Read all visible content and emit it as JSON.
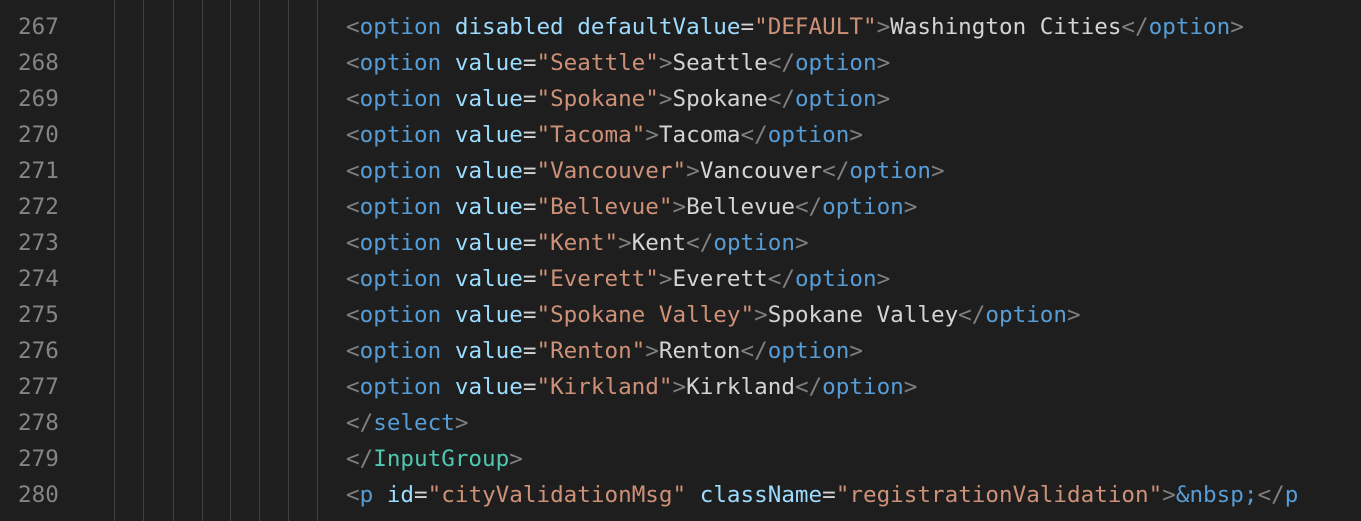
{
  "editor": {
    "top_partial": "/ , / , ,",
    "lines": [
      {
        "number": "267",
        "tokens": [
          {
            "k": "punct",
            "t": "<"
          },
          {
            "k": "tag",
            "t": "option"
          },
          {
            "k": "text",
            "t": " "
          },
          {
            "k": "attr",
            "t": "disabled"
          },
          {
            "k": "text",
            "t": " "
          },
          {
            "k": "attr",
            "t": "defaultValue"
          },
          {
            "k": "eq",
            "t": "="
          },
          {
            "k": "str",
            "t": "\"DEFAULT\""
          },
          {
            "k": "punct",
            "t": ">"
          },
          {
            "k": "text",
            "t": "Washington Cities"
          },
          {
            "k": "punct",
            "t": "</"
          },
          {
            "k": "tag",
            "t": "option"
          },
          {
            "k": "punct",
            "t": ">"
          }
        ]
      },
      {
        "number": "268",
        "tokens": [
          {
            "k": "punct",
            "t": "<"
          },
          {
            "k": "tag",
            "t": "option"
          },
          {
            "k": "text",
            "t": " "
          },
          {
            "k": "attr",
            "t": "value"
          },
          {
            "k": "eq",
            "t": "="
          },
          {
            "k": "str",
            "t": "\"Seattle\""
          },
          {
            "k": "punct",
            "t": ">"
          },
          {
            "k": "text",
            "t": "Seattle"
          },
          {
            "k": "punct",
            "t": "</"
          },
          {
            "k": "tag",
            "t": "option"
          },
          {
            "k": "punct",
            "t": ">"
          }
        ]
      },
      {
        "number": "269",
        "tokens": [
          {
            "k": "punct",
            "t": "<"
          },
          {
            "k": "tag",
            "t": "option"
          },
          {
            "k": "text",
            "t": " "
          },
          {
            "k": "attr",
            "t": "value"
          },
          {
            "k": "eq",
            "t": "="
          },
          {
            "k": "str",
            "t": "\"Spokane\""
          },
          {
            "k": "punct",
            "t": ">"
          },
          {
            "k": "text",
            "t": "Spokane"
          },
          {
            "k": "punct",
            "t": "</"
          },
          {
            "k": "tag",
            "t": "option"
          },
          {
            "k": "punct",
            "t": ">"
          }
        ]
      },
      {
        "number": "270",
        "tokens": [
          {
            "k": "punct",
            "t": "<"
          },
          {
            "k": "tag",
            "t": "option"
          },
          {
            "k": "text",
            "t": " "
          },
          {
            "k": "attr",
            "t": "value"
          },
          {
            "k": "eq",
            "t": "="
          },
          {
            "k": "str",
            "t": "\"Tacoma\""
          },
          {
            "k": "punct",
            "t": ">"
          },
          {
            "k": "text",
            "t": "Tacoma"
          },
          {
            "k": "punct",
            "t": "</"
          },
          {
            "k": "tag",
            "t": "option"
          },
          {
            "k": "punct",
            "t": ">"
          }
        ]
      },
      {
        "number": "271",
        "tokens": [
          {
            "k": "punct",
            "t": "<"
          },
          {
            "k": "tag",
            "t": "option"
          },
          {
            "k": "text",
            "t": " "
          },
          {
            "k": "attr",
            "t": "value"
          },
          {
            "k": "eq",
            "t": "="
          },
          {
            "k": "str",
            "t": "\"Vancouver\""
          },
          {
            "k": "punct",
            "t": ">"
          },
          {
            "k": "text",
            "t": "Vancouver"
          },
          {
            "k": "punct",
            "t": "</"
          },
          {
            "k": "tag",
            "t": "option"
          },
          {
            "k": "punct",
            "t": ">"
          }
        ]
      },
      {
        "number": "272",
        "tokens": [
          {
            "k": "punct",
            "t": "<"
          },
          {
            "k": "tag",
            "t": "option"
          },
          {
            "k": "text",
            "t": " "
          },
          {
            "k": "attr",
            "t": "value"
          },
          {
            "k": "eq",
            "t": "="
          },
          {
            "k": "str",
            "t": "\"Bellevue\""
          },
          {
            "k": "punct",
            "t": ">"
          },
          {
            "k": "text",
            "t": "Bellevue"
          },
          {
            "k": "punct",
            "t": "</"
          },
          {
            "k": "tag",
            "t": "option"
          },
          {
            "k": "punct",
            "t": ">"
          }
        ]
      },
      {
        "number": "273",
        "tokens": [
          {
            "k": "punct",
            "t": "<"
          },
          {
            "k": "tag",
            "t": "option"
          },
          {
            "k": "text",
            "t": " "
          },
          {
            "k": "attr",
            "t": "value"
          },
          {
            "k": "eq",
            "t": "="
          },
          {
            "k": "str",
            "t": "\"Kent\""
          },
          {
            "k": "punct",
            "t": ">"
          },
          {
            "k": "text",
            "t": "Kent"
          },
          {
            "k": "punct",
            "t": "</"
          },
          {
            "k": "tag",
            "t": "option"
          },
          {
            "k": "punct",
            "t": ">"
          }
        ]
      },
      {
        "number": "274",
        "tokens": [
          {
            "k": "punct",
            "t": "<"
          },
          {
            "k": "tag",
            "t": "option"
          },
          {
            "k": "text",
            "t": " "
          },
          {
            "k": "attr",
            "t": "value"
          },
          {
            "k": "eq",
            "t": "="
          },
          {
            "k": "str",
            "t": "\"Everett\""
          },
          {
            "k": "punct",
            "t": ">"
          },
          {
            "k": "text",
            "t": "Everett"
          },
          {
            "k": "punct",
            "t": "</"
          },
          {
            "k": "tag",
            "t": "option"
          },
          {
            "k": "punct",
            "t": ">"
          }
        ]
      },
      {
        "number": "275",
        "tokens": [
          {
            "k": "punct",
            "t": "<"
          },
          {
            "k": "tag",
            "t": "option"
          },
          {
            "k": "text",
            "t": " "
          },
          {
            "k": "attr",
            "t": "value"
          },
          {
            "k": "eq",
            "t": "="
          },
          {
            "k": "str",
            "t": "\"Spokane Valley\""
          },
          {
            "k": "punct",
            "t": ">"
          },
          {
            "k": "text",
            "t": "Spokane Valley"
          },
          {
            "k": "punct",
            "t": "</"
          },
          {
            "k": "tag",
            "t": "option"
          },
          {
            "k": "punct",
            "t": ">"
          }
        ]
      },
      {
        "number": "276",
        "tokens": [
          {
            "k": "punct",
            "t": "<"
          },
          {
            "k": "tag",
            "t": "option"
          },
          {
            "k": "text",
            "t": " "
          },
          {
            "k": "attr",
            "t": "value"
          },
          {
            "k": "eq",
            "t": "="
          },
          {
            "k": "str",
            "t": "\"Renton\""
          },
          {
            "k": "punct",
            "t": ">"
          },
          {
            "k": "text",
            "t": "Renton"
          },
          {
            "k": "punct",
            "t": "</"
          },
          {
            "k": "tag",
            "t": "option"
          },
          {
            "k": "punct",
            "t": ">"
          }
        ]
      },
      {
        "number": "277",
        "tokens": [
          {
            "k": "punct",
            "t": "<"
          },
          {
            "k": "tag",
            "t": "option"
          },
          {
            "k": "text",
            "t": " "
          },
          {
            "k": "attr",
            "t": "value"
          },
          {
            "k": "eq",
            "t": "="
          },
          {
            "k": "str",
            "t": "\"Kirkland\""
          },
          {
            "k": "punct",
            "t": ">"
          },
          {
            "k": "text",
            "t": "Kirkland"
          },
          {
            "k": "punct",
            "t": "</"
          },
          {
            "k": "tag",
            "t": "option"
          },
          {
            "k": "punct",
            "t": ">"
          }
        ]
      },
      {
        "number": "278",
        "tokens": [
          {
            "k": "punct",
            "t": "</"
          },
          {
            "k": "tag",
            "t": "select"
          },
          {
            "k": "punct",
            "t": ">"
          }
        ]
      },
      {
        "number": "279",
        "tokens": [
          {
            "k": "punct",
            "t": "</"
          },
          {
            "k": "comp",
            "t": "InputGroup"
          },
          {
            "k": "punct",
            "t": ">"
          }
        ]
      },
      {
        "number": "280",
        "tokens": [
          {
            "k": "punct",
            "t": "<"
          },
          {
            "k": "tag",
            "t": "p"
          },
          {
            "k": "text",
            "t": " "
          },
          {
            "k": "attr",
            "t": "id"
          },
          {
            "k": "eq",
            "t": "="
          },
          {
            "k": "str",
            "t": "\"cityValidationMsg\""
          },
          {
            "k": "text",
            "t": " "
          },
          {
            "k": "attr",
            "t": "className"
          },
          {
            "k": "eq",
            "t": "="
          },
          {
            "k": "str",
            "t": "\"registrationValidation\""
          },
          {
            "k": "punct",
            "t": ">"
          },
          {
            "k": "ent",
            "t": "&nbsp;"
          },
          {
            "k": "punct",
            "t": "</"
          },
          {
            "k": "tag",
            "t": "p"
          }
        ]
      }
    ]
  },
  "colors": {
    "background": "#1e1e1e",
    "line_number": "#858585",
    "punctuation": "#808080",
    "tag": "#569cd6",
    "component": "#4ec9b0",
    "attribute": "#9cdcfe",
    "string": "#ce9178",
    "text": "#d4d4d4"
  }
}
